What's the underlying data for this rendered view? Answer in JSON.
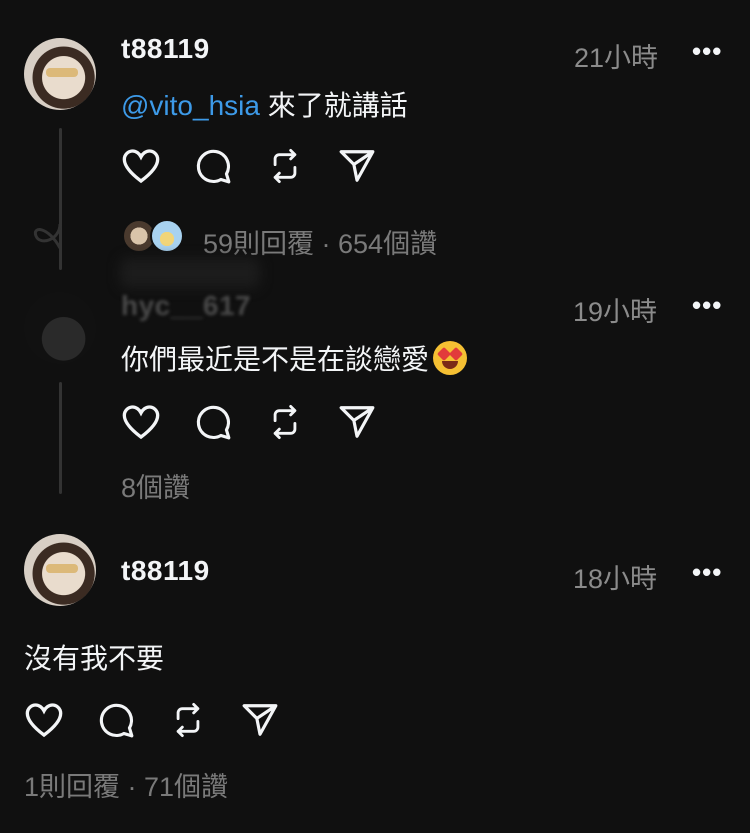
{
  "posts": [
    {
      "username": "t88119",
      "time": "21小時",
      "more": "•••",
      "mention": "@vito_hsia",
      "text": " 來了就講話",
      "stats": "59則回覆 · 654個讚"
    },
    {
      "username": "hyc__617",
      "time": "19小時",
      "more": "•••",
      "text": "你們最近是不是在談戀愛",
      "stats": "8個讚"
    },
    {
      "username": "t88119",
      "time": "18小時",
      "more": "•••",
      "text": "沒有我不要",
      "stats": "1則回覆 · 71個讚"
    }
  ],
  "icons": [
    "heart-icon",
    "comment-icon",
    "repost-icon",
    "share-icon"
  ],
  "colors": {
    "background": "#101010",
    "mention": "#3d9ae8",
    "muted": "#8b8b8b"
  }
}
